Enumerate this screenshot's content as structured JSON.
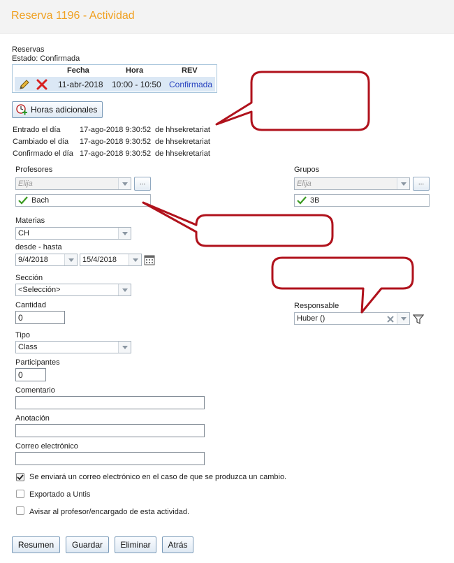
{
  "header": {
    "title": "Reserva 1196 - Actividad"
  },
  "reservations": {
    "label": "Reservas",
    "status": "Estado: Confirmada",
    "columns": [
      "Fecha",
      "Hora",
      "REV"
    ],
    "row": {
      "date": "11-abr-2018",
      "time": "10:00 - 10:50",
      "rev": "Confirmada"
    }
  },
  "extra_hours_button": "Horas adicionales",
  "info": [
    {
      "label": "Entrado el día",
      "datetime": "17-ago-2018 9:30:52",
      "by": "de  hhsekretariat"
    },
    {
      "label": "Cambiado el día",
      "datetime": "17-ago-2018 9:30:52",
      "by": "de  hhsekretariat"
    },
    {
      "label": "Confirmado el día",
      "datetime": "17-ago-2018 9:30:52",
      "by": "de  hhsekretariat"
    }
  ],
  "teachers": {
    "label": "Profesores",
    "placeholder": "Elija",
    "dots": "...",
    "selected": "Bach"
  },
  "groups": {
    "label": "Grupos",
    "placeholder": "Elija",
    "dots": "...",
    "selected": "3B"
  },
  "subjects": {
    "label": "Materias",
    "value": "CH"
  },
  "date_range": {
    "label": "desde - hasta",
    "from": "9/4/2018",
    "to": "15/4/2018"
  },
  "section": {
    "label": "Sección",
    "value": "<Selección>"
  },
  "quantity": {
    "label": "Cantidad",
    "value": "0"
  },
  "responsible": {
    "label": "Responsable",
    "value": "Huber ()"
  },
  "type": {
    "label": "Tipo",
    "value": "Class"
  },
  "participants": {
    "label": "Participantes",
    "value": "0"
  },
  "comment": {
    "label": "Comentario",
    "value": ""
  },
  "annotation": {
    "label": "Anotación",
    "value": ""
  },
  "email": {
    "label": "Correo electrónico",
    "value": ""
  },
  "checkboxes": [
    {
      "label": "Se enviará un correo electrónico en el caso de que se produzca un cambio.",
      "checked": true
    },
    {
      "label": "Exportado a Untis",
      "checked": false
    },
    {
      "label": "Avisar al profesor/encargado de esta actividad.",
      "checked": false
    }
  ],
  "buttons": {
    "summary": "Resumen",
    "save": "Guardar",
    "delete": "Eliminar",
    "back": "Atrás"
  },
  "colors": {
    "title": "#f0a020",
    "callout_border": "#b0121c",
    "link": "#2a45c0"
  }
}
